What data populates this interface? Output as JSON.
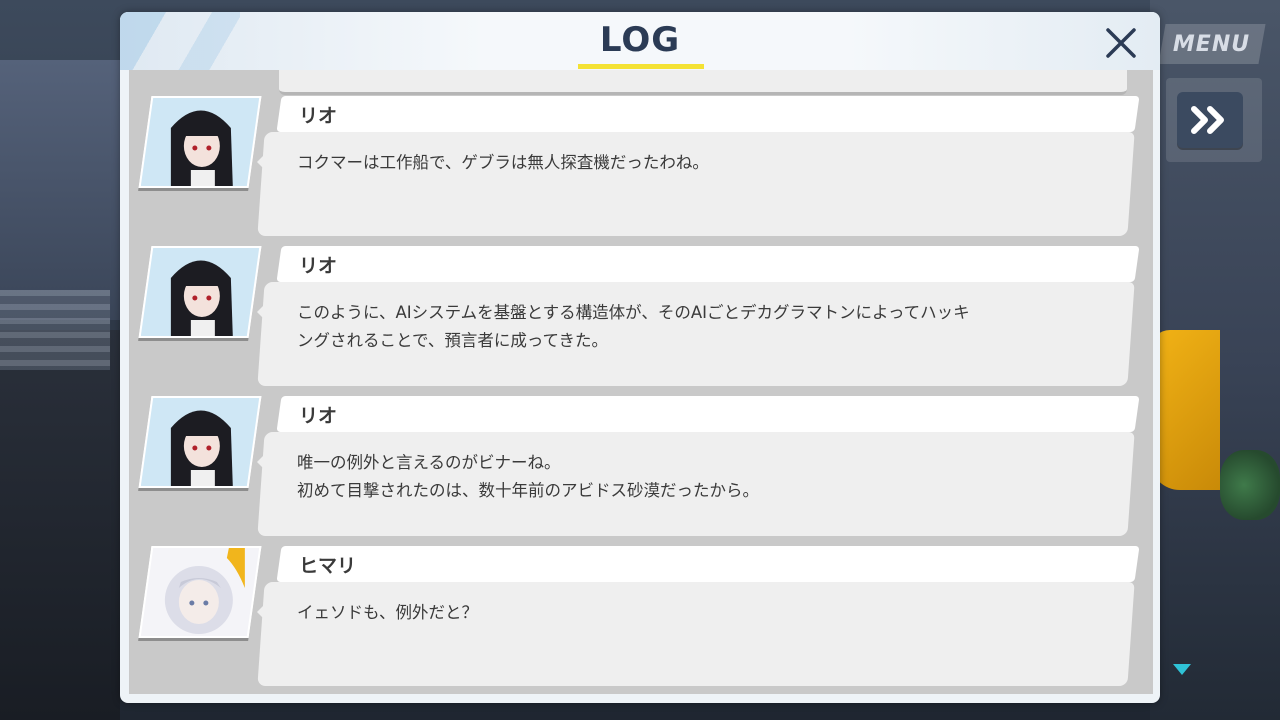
{
  "hud": {
    "menu_label": "MENU"
  },
  "log": {
    "title": "LOG",
    "entries": [
      {
        "speaker": "リオ",
        "lines": [
          "コクマーは工作船で、ゲブラは無人探査機だったわね。"
        ]
      },
      {
        "speaker": "リオ",
        "lines": [
          "このように、AIシステムを基盤とする構造体が、そのAIごとデカグラマトンによってハッキ",
          "ングされることで、預言者に成ってきた。"
        ]
      },
      {
        "speaker": "リオ",
        "lines": [
          "唯一の例外と言えるのがビナーね。",
          "初めて目撃されたのは、数十年前のアビドス砂漠だったから。"
        ]
      },
      {
        "speaker": "ヒマリ",
        "lines": [
          "イェソドも、例外だと？"
        ]
      }
    ]
  },
  "colors": {
    "accent_underline": "#f4e234",
    "title": "#2b3b55"
  }
}
